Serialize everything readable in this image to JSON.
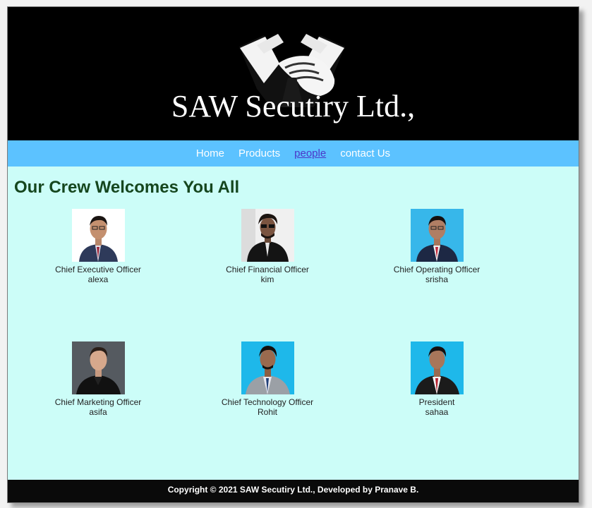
{
  "header": {
    "title": "SAW Secutiry Ltd.,"
  },
  "nav": {
    "items": [
      "Home",
      "Products",
      "people",
      "contact Us"
    ],
    "active": "people"
  },
  "main": {
    "heading": "Our Crew Welcomes You All",
    "members": [
      {
        "role": "Chief Executive Officer",
        "name": "alexa",
        "photo_bg": "#ffffff"
      },
      {
        "role": "Chief Financial Officer",
        "name": "kim",
        "photo_bg": "#f0f0f0"
      },
      {
        "role": "Chief Operating Officer",
        "name": "srisha",
        "photo_bg": "#37b7ea"
      },
      {
        "role": "Chief Marketing Officer",
        "name": "asifa",
        "photo_bg": "#555a60"
      },
      {
        "role": "Chief Technology Officer",
        "name": "Rohit",
        "photo_bg": "#1eb8ea"
      },
      {
        "role": "President",
        "name": "sahaa",
        "photo_bg": "#1eb8ea"
      }
    ]
  },
  "footer": {
    "text": "Copyright © 2021 SAW Secutiry Ltd., Developed by Pranave B."
  },
  "colors": {
    "header_bg": "#000000",
    "nav_bg": "#5cc2ff",
    "content_bg": "#ccfdf8",
    "heading": "#15461e",
    "active_link": "#4b38c9"
  }
}
